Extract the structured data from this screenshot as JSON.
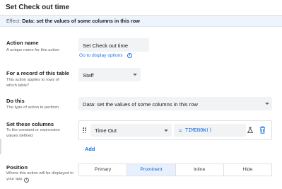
{
  "header": {
    "title": "Set Check out time"
  },
  "effect": {
    "label": "Effect:",
    "value": "Data: set the values of some columns in this row"
  },
  "action_name": {
    "label": "Action name",
    "help": "A unique name for this action",
    "value": "Set Check out time",
    "link": "Go to display options"
  },
  "table_record": {
    "label": "For a record of this table",
    "help": "This action applies to rows of which table?",
    "value": "Staff"
  },
  "do_this": {
    "label": "Do this",
    "help": "The type of action to perform",
    "value": "Data: set the values of some columns in this row"
  },
  "set_columns": {
    "label": "Set these columns",
    "help": "To the constant or expression values defined",
    "column": "Time Out",
    "equals": "=",
    "expression": "TIMENOW()",
    "add_label": "Add"
  },
  "position": {
    "label": "Position",
    "help": "Where this action will be displayed in your app",
    "options": [
      "Primary",
      "Prominent",
      "Inline",
      "Hide"
    ],
    "selected": "Prominent"
  },
  "colors": {
    "accent": "#1a73e8",
    "input_bg": "#f1f3f4",
    "effect_bg": "#eef4fb",
    "selected_bg": "#e8f0fe"
  },
  "icons": {
    "info": "info-icon",
    "caret": "chevron-down-icon",
    "drag": "drag-handle-icon",
    "flask": "flask-icon",
    "trash": "trash-icon"
  }
}
